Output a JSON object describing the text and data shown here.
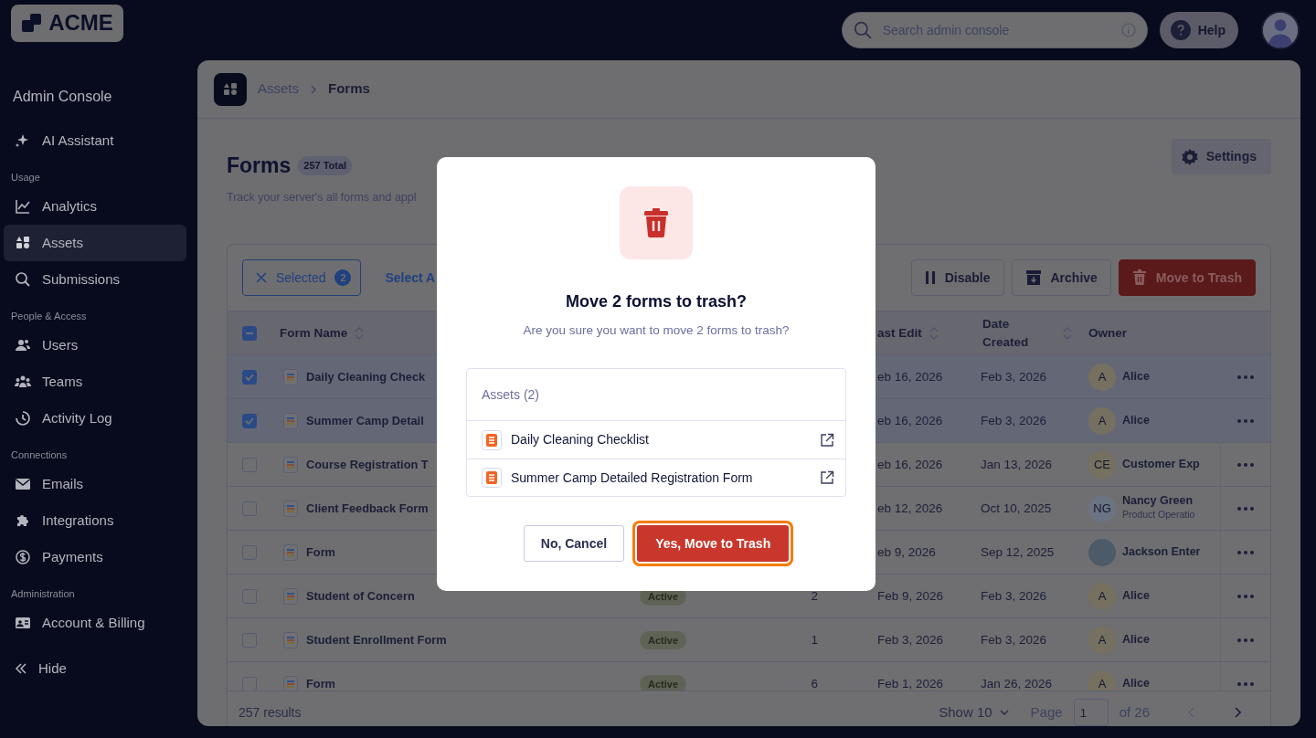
{
  "logo": {
    "text": "ACME"
  },
  "topbar": {
    "search": {
      "placeholder": "Search admin console"
    },
    "help": "Help"
  },
  "sidebar": {
    "title": "Admin Console",
    "top_items": [
      {
        "label": "AI Assistant",
        "selected": false
      }
    ],
    "sections": [
      {
        "heading": "Usage",
        "items": [
          {
            "label": "Analytics",
            "selected": false
          },
          {
            "label": "Assets",
            "selected": true
          },
          {
            "label": "Submissions",
            "selected": false
          }
        ]
      },
      {
        "heading": "People & Access",
        "items": [
          {
            "label": "Users",
            "selected": false
          },
          {
            "label": "Teams",
            "selected": false
          },
          {
            "label": "Activity Log",
            "selected": false
          }
        ]
      },
      {
        "heading": "Connections",
        "items": [
          {
            "label": "Emails",
            "selected": false
          },
          {
            "label": "Integrations",
            "selected": false
          },
          {
            "label": "Payments",
            "selected": false
          }
        ]
      },
      {
        "heading": "Administration",
        "items": [
          {
            "label": "Account & Billing",
            "selected": false
          }
        ]
      }
    ],
    "hide": "Hide"
  },
  "breadcrumb": [
    "Assets",
    "Forms"
  ],
  "page": {
    "title": "Forms",
    "total": "257 Total",
    "subtitle": "Track your server's all forms and appl",
    "settings": "Settings"
  },
  "toolbar": {
    "selected_label": "Selected",
    "selected_count": "2",
    "select_all": "Select A",
    "actions": [
      {
        "label": "Disable",
        "kind": "disable"
      },
      {
        "label": "Archive",
        "kind": "archive"
      },
      {
        "label": "Move to Trash",
        "kind": "trash"
      }
    ]
  },
  "table": {
    "header_indeterminate": true,
    "columns": [
      {
        "label": "Form Name",
        "sortable": true
      },
      {
        "label": "ast Edit",
        "sortable": true
      },
      {
        "label": "Date Created",
        "sortable": true
      },
      {
        "label": "Owner",
        "sortable": false
      }
    ],
    "rows": [
      {
        "checked": true,
        "name": "Daily Cleaning Check",
        "last_edit": "eb 16, 2026",
        "created": "Feb 3, 2026",
        "owner": {
          "kind": "initials",
          "initials": "A",
          "color": "#767060",
          "name": "Alice"
        }
      },
      {
        "checked": true,
        "name": "Summer Camp Detail",
        "last_edit": "eb 16, 2026",
        "created": "Feb 3, 2026",
        "owner": {
          "kind": "initials",
          "initials": "A",
          "color": "#767060",
          "name": "Alice"
        }
      },
      {
        "checked": false,
        "name": "Course Registration T",
        "last_edit": "eb 16, 2026",
        "created": "Jan 13, 2026",
        "owner": {
          "kind": "initials",
          "initials": "CE",
          "color": "#767060",
          "name": "Customer Exp"
        }
      },
      {
        "checked": false,
        "name": "Client Feedback Form",
        "last_edit": "eb 12, 2026",
        "created": "Oct 10, 2025",
        "owner": {
          "kind": "initials",
          "initials": "NG",
          "color": "#6b7482",
          "name": "Nancy Green",
          "subtitle": "Product Operatio"
        }
      },
      {
        "checked": false,
        "name": "Form",
        "last_edit": "eb 9, 2026",
        "created": "Sep 12, 2025",
        "owner": {
          "kind": "photo",
          "name": "Jackson Enter"
        }
      },
      {
        "checked": false,
        "name": "Student of Concern",
        "status": "Active",
        "count": "2",
        "last_edit": "Feb 9, 2026",
        "created": "Feb 3, 2026",
        "owner": {
          "kind": "initials",
          "initials": "A",
          "color": "#767060",
          "name": "Alice"
        }
      },
      {
        "checked": false,
        "name": "Student Enrollment Form",
        "status": "Active",
        "count": "1",
        "last_edit": "Feb 3, 2026",
        "created": "Feb 3, 2026",
        "owner": {
          "kind": "initials",
          "initials": "A",
          "color": "#767060",
          "name": "Alice"
        }
      },
      {
        "checked": false,
        "name": "Form",
        "status": "Active",
        "count": "6",
        "last_edit": "Feb 1, 2026",
        "created": "Jan 26, 2026",
        "owner": {
          "kind": "initials",
          "initials": "A",
          "color": "#767060",
          "name": "Alice"
        }
      }
    ],
    "footer": {
      "results": "257 results",
      "show": "Show 10",
      "page_label": "Page",
      "page": "1",
      "of": "of 26"
    }
  },
  "modal": {
    "title": "Move 2 forms to trash?",
    "message": "Are you sure you want to move 2 forms to trash?",
    "assets_heading": "Assets (2)",
    "assets": [
      "Daily Cleaning Checklist",
      "Summer Camp Detailed Registration Form"
    ],
    "cancel": "No, Cancel",
    "confirm": "Yes, Move to Trash",
    "confirm_focused": true
  }
}
